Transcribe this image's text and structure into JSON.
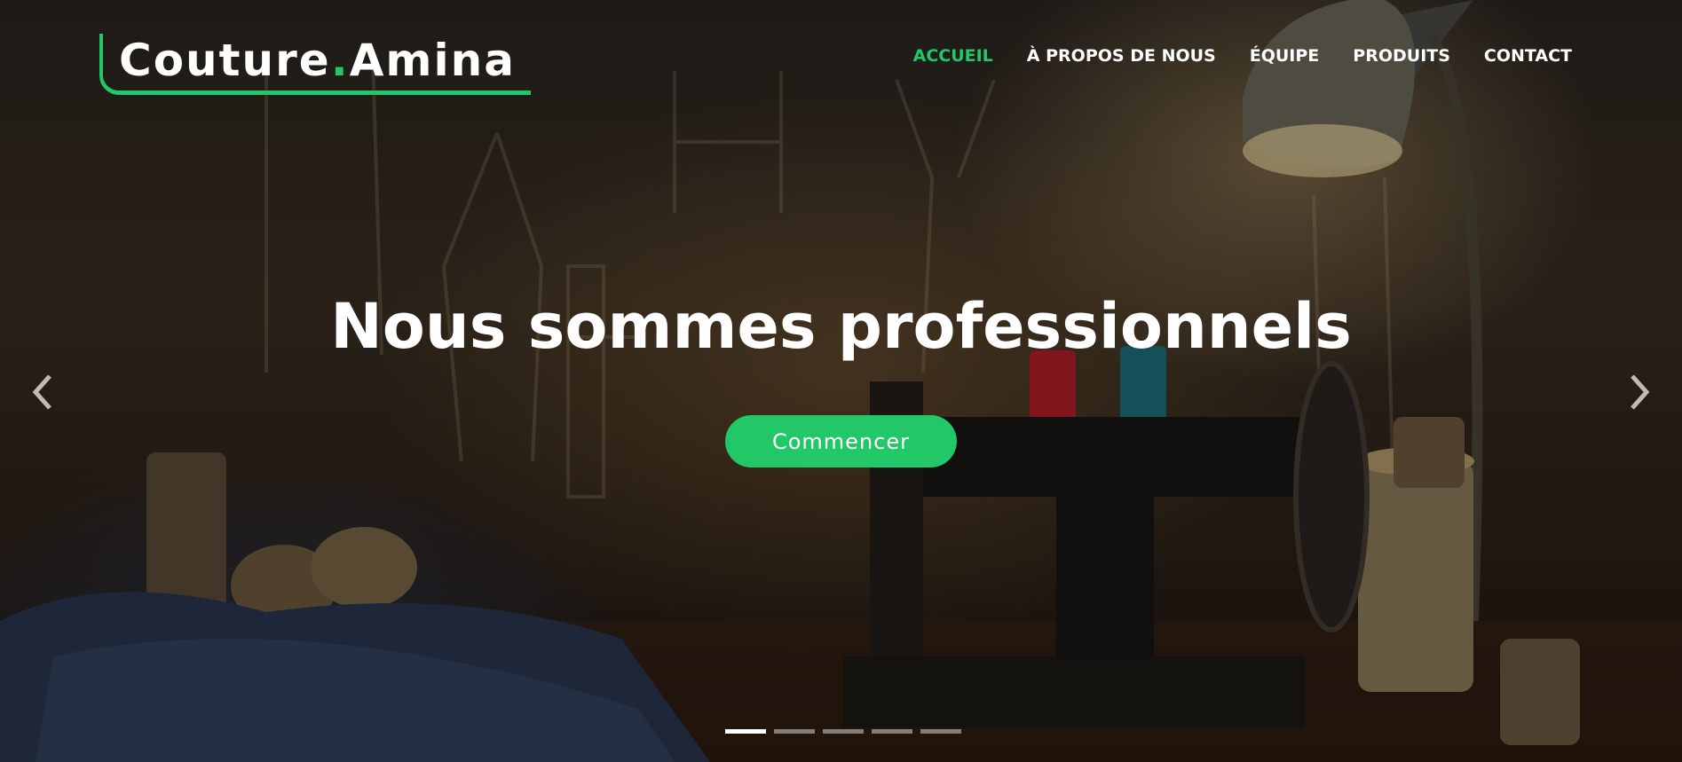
{
  "brand": {
    "name_part1": "Couture",
    "dot": ".",
    "name_part2": "Amina",
    "accent_color": "#22c767"
  },
  "nav": {
    "items": [
      {
        "label": "ACCUEIL",
        "active": true
      },
      {
        "label": "À PROPOS DE NOUS",
        "active": false
      },
      {
        "label": "ÉQUIPE",
        "active": false
      },
      {
        "label": "PRODUITS",
        "active": false
      },
      {
        "label": "CONTACT",
        "active": false
      }
    ]
  },
  "hero": {
    "title": "Nous sommes professionnels",
    "cta_label": "Commencer",
    "prev_icon": "chevron-left-icon",
    "next_icon": "chevron-right-icon",
    "slide_count": 5,
    "active_slide": 1
  }
}
